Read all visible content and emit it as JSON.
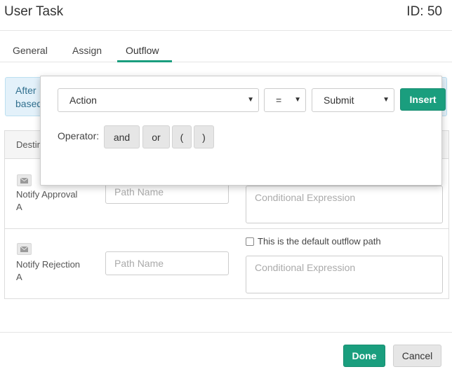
{
  "header": {
    "title": "User Task",
    "id_label": "ID: 50"
  },
  "tabs": [
    {
      "label": "General",
      "active": false
    },
    {
      "label": "Assign",
      "active": false
    },
    {
      "label": "Outflow",
      "active": true
    }
  ],
  "info_banner": {
    "line1": "After",
    "line2": "based"
  },
  "table": {
    "header_label": "Destin"
  },
  "outflow_rows": [
    {
      "icon": "envelope-icon",
      "recipient_line1": "Notify Approval",
      "recipient_line2": "A",
      "path_name_placeholder": "Path Name",
      "expression_placeholder": "Conditional Expression"
    },
    {
      "icon": "envelope-icon",
      "recipient_line1": "Notify Rejection",
      "recipient_line2": "A",
      "path_name_placeholder": "Path Name",
      "default_path_label": "This is the default outflow path",
      "default_path_checked": false,
      "expression_placeholder": "Conditional Expression"
    }
  ],
  "expression_builder": {
    "field_select": "Action",
    "operator_select": "=",
    "value_select": "Submit",
    "insert_label": "Insert",
    "operator_label": "Operator:",
    "operators": [
      "and",
      "or",
      "(",
      ")"
    ]
  },
  "footer": {
    "done_label": "Done",
    "cancel_label": "Cancel"
  },
  "colors": {
    "accent": "#1a9e7e",
    "info_bg": "#e3f1fa",
    "info_text": "#31708f"
  }
}
